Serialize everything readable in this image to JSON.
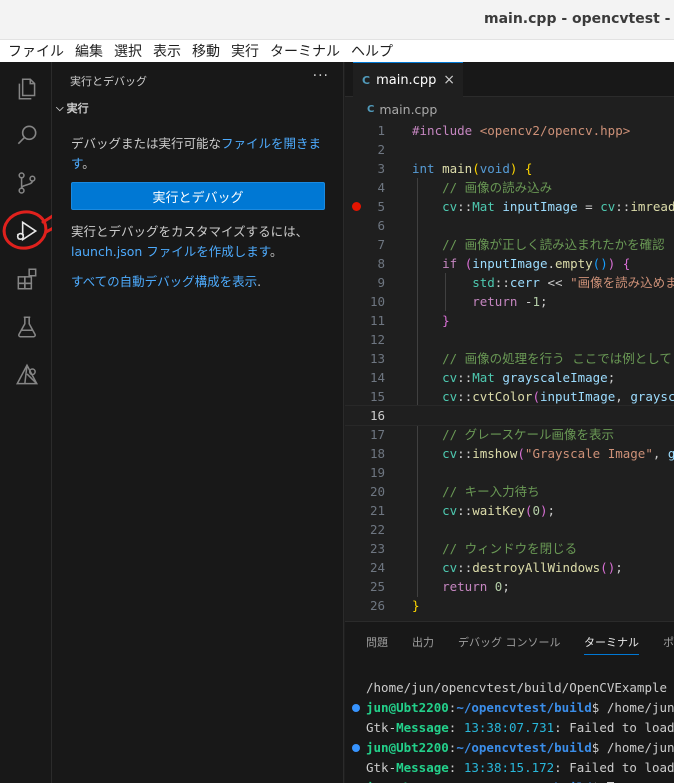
{
  "window": {
    "title": "main.cpp - opencvtest - Vis"
  },
  "menu": [
    "ファイル",
    "編集",
    "選択",
    "表示",
    "移動",
    "実行",
    "ターミナル",
    "ヘルプ"
  ],
  "activity_bar": {
    "items": [
      {
        "icon": "explorer-icon"
      },
      {
        "icon": "search-icon"
      },
      {
        "icon": "source-control-icon"
      },
      {
        "icon": "run-and-debug-icon",
        "active": true
      },
      {
        "icon": "extensions-icon"
      },
      {
        "icon": "testing-icon"
      },
      {
        "icon": "cmake-icon"
      }
    ]
  },
  "sidebar": {
    "title": "実行とデバッグ",
    "more": "···",
    "section": "実行",
    "text1_prefix": "デバッグまたは実行可能な",
    "text1_link": "ファイルを開きます",
    "text1_suffix": "。",
    "run_button": "実行とデバッグ",
    "text2_prefix": "実行とデバッグをカスタマイズするには、",
    "text2_link": "launch.json ファイルを作成します",
    "text2_suffix": "。",
    "text3_link": "すべての自動デバッグ構成を表示",
    "text3_suffix": "."
  },
  "editor": {
    "tab_icon": "C",
    "tab_label": "main.cpp",
    "tab_close": "×",
    "breadcrumb": "main.cpp",
    "line_numbers": [
      "1",
      "2",
      "3",
      "4",
      "5",
      "6",
      "7",
      "8",
      "9",
      "10",
      "11",
      "12",
      "13",
      "14",
      "15",
      "16",
      "17",
      "18",
      "19",
      "20",
      "21",
      "22",
      "23",
      "24",
      "25",
      "26"
    ],
    "active_line": 16,
    "breakpoint_line": 5
  },
  "panel": {
    "tabs": [
      "問題",
      "出力",
      "デバッグ コンソール",
      "ターミナル",
      "ポ"
    ],
    "active_tab": "ターミナル",
    "terminal": {
      "line1": "/home/jun/opencvtest/build/OpenCVExample",
      "user": "jun@Ubt2200",
      "path": "~/opencvtest/build",
      "cmd": "$ /home/jun/op",
      "gtk": "Gtk-",
      "message": "Message",
      "time1": "13:38:07.731",
      "time2": "13:38:15.172",
      "msg_tail": ": Failed to load mo",
      "cmd_last": "$ "
    }
  },
  "colors": {
    "accent": "#0078d4",
    "link": "#4daafc",
    "breakpoint": "#e51400",
    "annotation": "#e0211d"
  }
}
